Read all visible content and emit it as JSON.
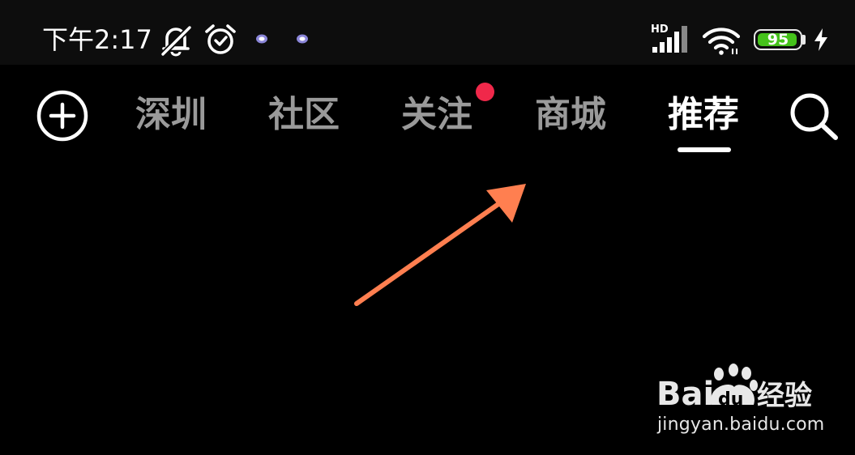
{
  "status_bar": {
    "time": "下午2:17",
    "battery_level": "95",
    "battery_fraction": 0.95,
    "network_label": "HD",
    "icons": [
      "mute-icon",
      "alarm-icon",
      "notification-app-icon",
      "notification-app-icon",
      "signal-icon",
      "wifi-icon",
      "battery-icon",
      "charging-icon"
    ],
    "colors": {
      "battery": "#45c21b",
      "background": "#0d0d0d"
    }
  },
  "nav": {
    "tabs": [
      {
        "label": "深圳",
        "active": false
      },
      {
        "label": "社区",
        "active": false
      },
      {
        "label": "关注",
        "active": false,
        "has_notification": true
      },
      {
        "label": "商城",
        "active": false
      },
      {
        "label": "推荐",
        "active": true
      }
    ],
    "icons": {
      "left": "add-circle-icon",
      "right": "search-icon"
    },
    "colors": {
      "active": "#ffffff",
      "inactive": "#9a9a9a",
      "notification": "#f0284a"
    }
  },
  "annotation": {
    "arrow_color": "#ff7f50",
    "icon": "arrow-pointer-icon"
  },
  "watermark": {
    "brand": "Bai du 经验",
    "url": "jingyan.baidu.com",
    "icon": "baidu-paw-logo"
  }
}
